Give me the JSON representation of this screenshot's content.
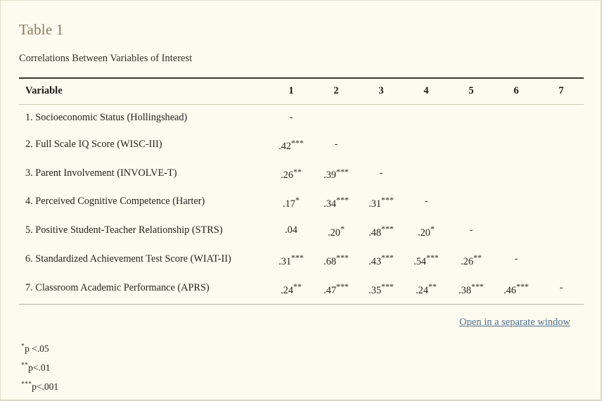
{
  "title": "Table 1",
  "caption": "Correlations Between Variables of Interest",
  "table": {
    "variable_header": "Variable",
    "column_headers": [
      "1",
      "2",
      "3",
      "4",
      "5",
      "6",
      "7"
    ],
    "rows": [
      {
        "label": "1. Socioeconomic Status (Hollingshead)",
        "cells": [
          {
            "value": "-",
            "stars": ""
          }
        ]
      },
      {
        "label": "2. Full Scale IQ Score (WISC-III)",
        "cells": [
          {
            "value": ".42",
            "stars": "***"
          },
          {
            "value": "-",
            "stars": ""
          }
        ]
      },
      {
        "label": "3. Parent Involvement (INVOLVE-T)",
        "cells": [
          {
            "value": ".26",
            "stars": "**"
          },
          {
            "value": ".39",
            "stars": "***"
          },
          {
            "value": "-",
            "stars": ""
          }
        ]
      },
      {
        "label": "4. Perceived Cognitive Competence (Harter)",
        "cells": [
          {
            "value": ".17",
            "stars": "*"
          },
          {
            "value": ".34",
            "stars": "***"
          },
          {
            "value": ".31",
            "stars": "***"
          },
          {
            "value": "-",
            "stars": ""
          }
        ]
      },
      {
        "label": "5. Positive Student-Teacher Relationship (STRS)",
        "cells": [
          {
            "value": ".04",
            "stars": ""
          },
          {
            "value": ".20",
            "stars": "*"
          },
          {
            "value": ".48",
            "stars": "***"
          },
          {
            "value": ".20",
            "stars": "*"
          },
          {
            "value": "-",
            "stars": ""
          }
        ]
      },
      {
        "label": "6. Standardized Achievement Test Score (WIAT-II)",
        "cells": [
          {
            "value": ".31",
            "stars": "***"
          },
          {
            "value": ".68",
            "stars": "***"
          },
          {
            "value": ".43",
            "stars": "***"
          },
          {
            "value": ".54",
            "stars": "***"
          },
          {
            "value": ".26",
            "stars": "**"
          },
          {
            "value": "-",
            "stars": ""
          }
        ]
      },
      {
        "label": "7. Classroom Academic Performance (APRS)",
        "cells": [
          {
            "value": ".24",
            "stars": "**"
          },
          {
            "value": ".47",
            "stars": "***"
          },
          {
            "value": ".35",
            "stars": "***"
          },
          {
            "value": ".24",
            "stars": "**"
          },
          {
            "value": ".38",
            "stars": "***"
          },
          {
            "value": ".46",
            "stars": "***"
          },
          {
            "value": "-",
            "stars": ""
          }
        ]
      }
    ]
  },
  "open_link": "Open in a separate window",
  "notes": [
    {
      "marker": "*",
      "text": "p <.05"
    },
    {
      "marker": "**",
      "text": "p<.01"
    },
    {
      "marker": "***",
      "text": "p<.001"
    }
  ],
  "colors": {
    "page_background": "#fdfbef",
    "title": "#8d7a62",
    "body_text": "#24221c",
    "link": "#4f6f91",
    "rule_top": "#3a362c",
    "rule_light": "#cfc9b4"
  }
}
